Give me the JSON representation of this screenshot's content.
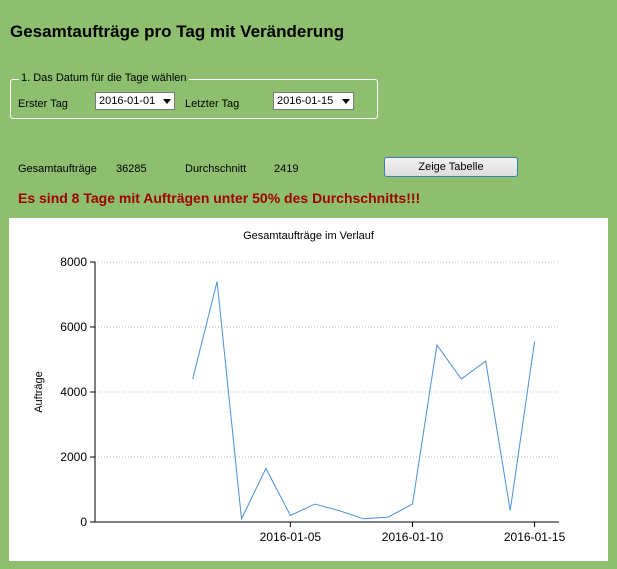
{
  "window": {
    "title": "Gesamtaufträge pro Tag mit Veränderung"
  },
  "date_group": {
    "legend": "1. Das Datum für die Tage wählen",
    "start_label": "Erster Tag",
    "start_value": "2016-01-01",
    "end_label": "Letzter Tag",
    "end_value": "2016-01-15"
  },
  "stats": {
    "total_label": "Gesamtaufträge",
    "total_value": "36285",
    "avg_label": "Durchschnitt",
    "avg_value": "2419",
    "show_table_button": "Zeige Tabelle"
  },
  "warning": "Es sind 8 Tage mit Aufträgen unter 50% des Durchschnitts!!!",
  "colors": {
    "background": "#8dbf6e",
    "warning": "#a00000",
    "line": "#4a90d9"
  },
  "chart_data": {
    "type": "line",
    "title": "Gesamtaufträge im Verlauf",
    "xlabel": "",
    "ylabel": "Aufträge",
    "x": [
      "2016-01-01",
      "2016-01-02",
      "2016-01-03",
      "2016-01-04",
      "2016-01-05",
      "2016-01-06",
      "2016-01-07",
      "2016-01-08",
      "2016-01-09",
      "2016-01-10",
      "2016-01-11",
      "2016-01-12",
      "2016-01-13",
      "2016-01-14",
      "2016-01-15"
    ],
    "values": [
      4400,
      7400,
      100,
      1650,
      200,
      550,
      350,
      100,
      150,
      550,
      5450,
      4400,
      4950,
      350,
      5550
    ],
    "ylim": [
      0,
      8000
    ],
    "yticks": [
      "0",
      "2000",
      "4000",
      "6000",
      "8000"
    ],
    "xticks": [
      "2016-01-05",
      "2016-01-10",
      "2016-01-15"
    ],
    "grid": true,
    "legend": "none"
  }
}
